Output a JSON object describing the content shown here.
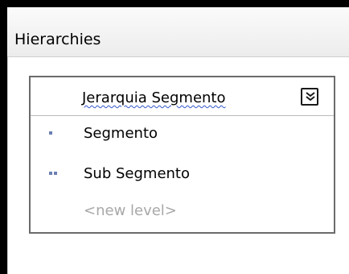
{
  "panel": {
    "title": "Hierarchies"
  },
  "hierarchy": {
    "name": "Jerarquia Segmento",
    "collapse_icon": "double-chevron-down-icon",
    "levels": [
      {
        "label": "Segmento",
        "depth": 1
      },
      {
        "label": "Sub Segmento",
        "depth": 2
      }
    ],
    "new_level_placeholder": "<new level>"
  },
  "colors": {
    "frame": "#000000",
    "header_bg": "#f2f2f2",
    "box_border": "#6b6b6b",
    "level_dot": "#6a7fb2",
    "placeholder_text": "#a8a8a8",
    "spell_underline": "#3355cc"
  }
}
